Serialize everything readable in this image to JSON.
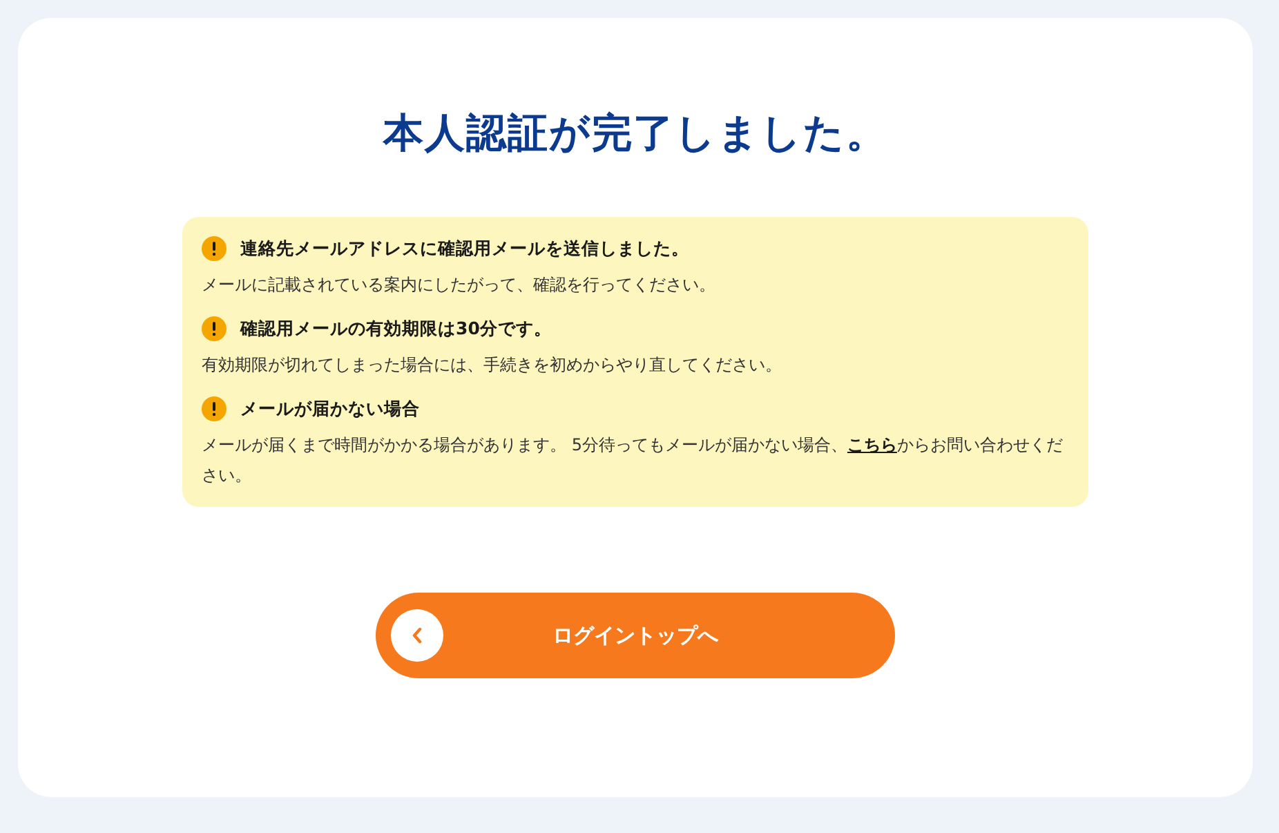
{
  "title": "本人認証が完了しました。",
  "notices": [
    {
      "heading": "連絡先メールアドレスに確認用メールを送信しました。",
      "body": [
        {
          "kind": "text",
          "text": "メールに記載されている案内にしたがって、確認を行ってください。"
        }
      ]
    },
    {
      "heading": "確認用メールの有効期限は30分です。",
      "body": [
        {
          "kind": "text",
          "text": "有効期限が切れてしまった場合には、手続きを初めからやり直してください。"
        }
      ]
    },
    {
      "heading": "メールが届かない場合",
      "body": [
        {
          "kind": "text",
          "text": "メールが届くまで時間がかかる場合があります。 5分待ってもメールが届かない場合、"
        },
        {
          "kind": "link",
          "text": "こちら"
        },
        {
          "kind": "text",
          "text": "からお問い合わせください。"
        }
      ]
    }
  ],
  "button": {
    "label": "ログイントップへ"
  }
}
